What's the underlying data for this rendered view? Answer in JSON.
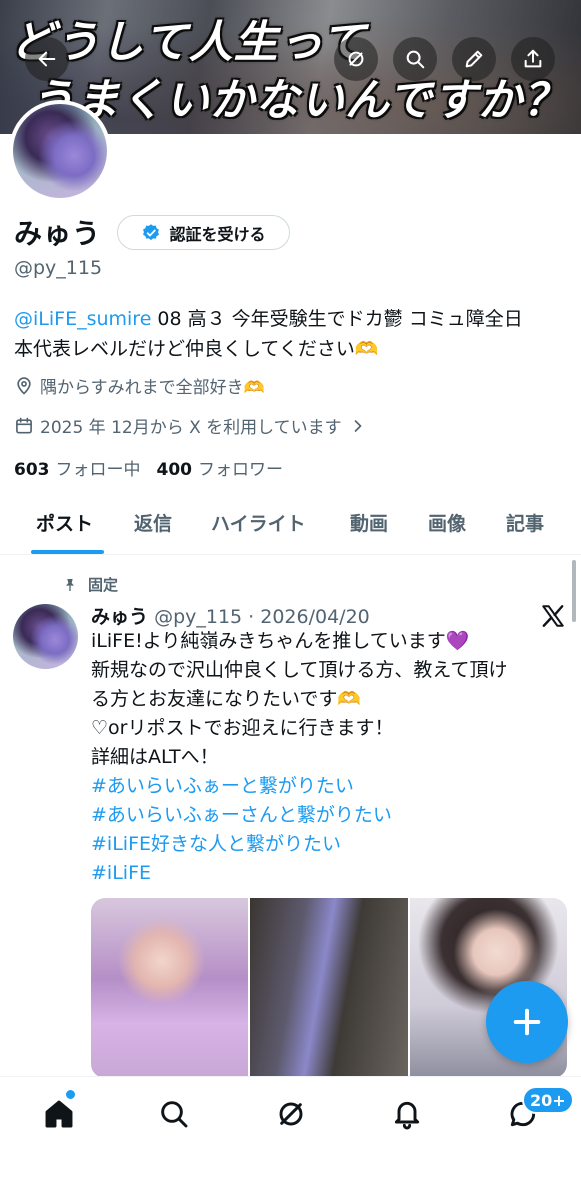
{
  "banner": {
    "line1": "どうして人生って",
    "line2": "うまくいかないんですか？"
  },
  "header_icons": [
    "back-icon",
    "grok-icon",
    "search-icon",
    "edit-icon",
    "share-icon"
  ],
  "profile": {
    "name": "みゅう",
    "verify_label": "認証を受ける",
    "handle": "@py_115",
    "bio_mention": "@iLiFE_sumire",
    "bio_text_1": " 08 高３ 今年受験生でドカ鬱 コミュ障全日",
    "bio_text_2": "本代表レベルだけど仲良くしてください🫶",
    "location": "隅からすみれまで全部好き🫶",
    "joined": "2025 年 12月から X を利用しています",
    "following_count": "603",
    "following_label": "フォロー中",
    "followers_count": "400",
    "followers_label": "フォロワー"
  },
  "tabs": [
    "ポスト",
    "返信",
    "ハイライト",
    "動画",
    "画像",
    "記事"
  ],
  "active_tab": "ポスト",
  "post": {
    "pinned_label": "固定",
    "author_name": "みゅう",
    "author_meta": "@py_115 · 2026/04/20",
    "lines": [
      "iLiFE!より純嶺みきちゃんを推しています💜",
      "新規なので沢山仲良くして頂ける方、教えて頂け",
      "る方とお友達になりたいです🫶",
      "♡orリポストでお迎えに行きます！",
      "詳細はALTへ！"
    ],
    "hashtags": [
      "#あいらいふぁーと繋がりたい",
      "#あいらいふぁーさんと繋がりたい",
      "#iLiFE好きな人と繋がりたい",
      "#iLiFE"
    ]
  },
  "bottom_nav": {
    "items": [
      "home-icon",
      "search-icon",
      "grok-icon",
      "notifications-icon",
      "messages-icon"
    ],
    "messages_badge": "20+"
  },
  "colors": {
    "accent": "#1d9bf0",
    "text": "#0f1419",
    "secondary": "#536471"
  }
}
